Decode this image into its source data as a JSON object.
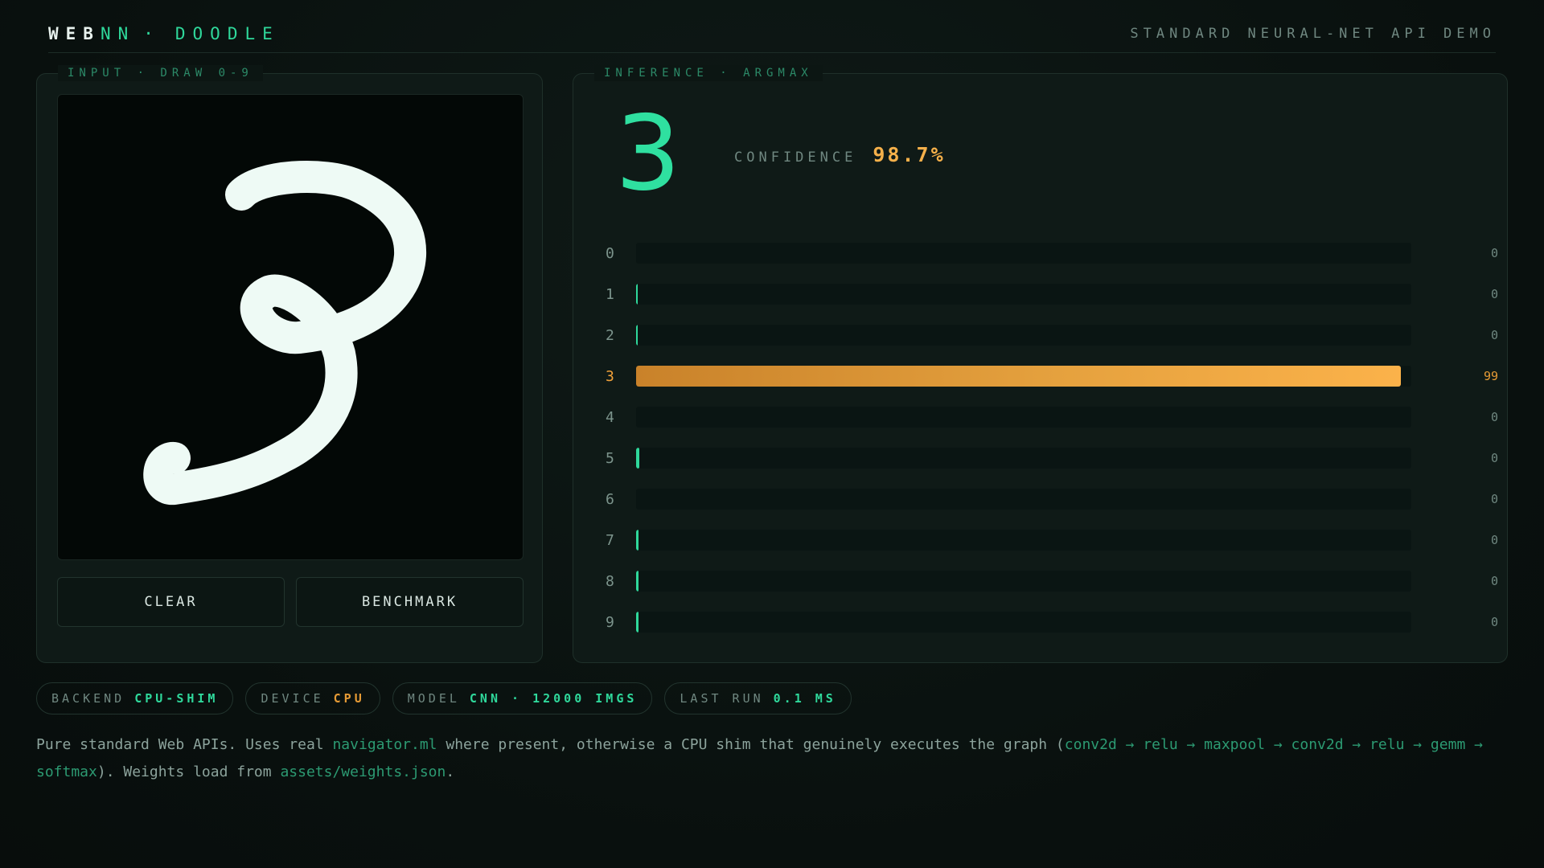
{
  "header": {
    "brand_a": "WEB",
    "brand_b": "NN",
    "brand_sep": "·",
    "brand_c": "DOODLE",
    "tagline": "STANDARD NEURAL-NET API DEMO"
  },
  "input_panel": {
    "label": "INPUT · DRAW 0-9",
    "clear_label": "CLEAR",
    "benchmark_label": "BENCHMARK"
  },
  "inference_panel": {
    "label": "INFERENCE · ARGMAX",
    "prediction": "3",
    "confidence_label": "CONFIDENCE",
    "confidence_value": "98.7%",
    "bars": [
      {
        "digit": "0",
        "value": "0",
        "fraction": 0.0
      },
      {
        "digit": "1",
        "value": "0",
        "fraction": 0.002
      },
      {
        "digit": "2",
        "value": "0",
        "fraction": 0.002
      },
      {
        "digit": "3",
        "value": "99",
        "fraction": 0.987
      },
      {
        "digit": "4",
        "value": "0",
        "fraction": 0.0
      },
      {
        "digit": "5",
        "value": "0",
        "fraction": 0.004
      },
      {
        "digit": "6",
        "value": "0",
        "fraction": 0.0
      },
      {
        "digit": "7",
        "value": "0",
        "fraction": 0.003
      },
      {
        "digit": "8",
        "value": "0",
        "fraction": 0.003
      },
      {
        "digit": "9",
        "value": "0",
        "fraction": 0.003
      }
    ]
  },
  "status": {
    "backend_label": "BACKEND",
    "backend_value": "CPU-SHIM",
    "device_label": "DEVICE",
    "device_value": "CPU",
    "model_label": "MODEL",
    "model_value": "CNN · 12000 IMGS",
    "last_run_label": "LAST RUN",
    "last_run_value": "0.1 MS"
  },
  "description": {
    "t1": "Pure standard Web APIs. Uses real ",
    "c1": "navigator.ml",
    "t2": " where present, otherwise a CPU shim that genuinely executes the graph (",
    "c2": "conv2d → relu → maxpool → conv2d → relu → gemm → softmax",
    "t3": "). Weights load from ",
    "c3": "assets/weights.json",
    "t4": "."
  },
  "colors": {
    "accent_green": "#2fd89b",
    "accent_orange": "#f5b04a",
    "stroke": "#eefaf5"
  }
}
